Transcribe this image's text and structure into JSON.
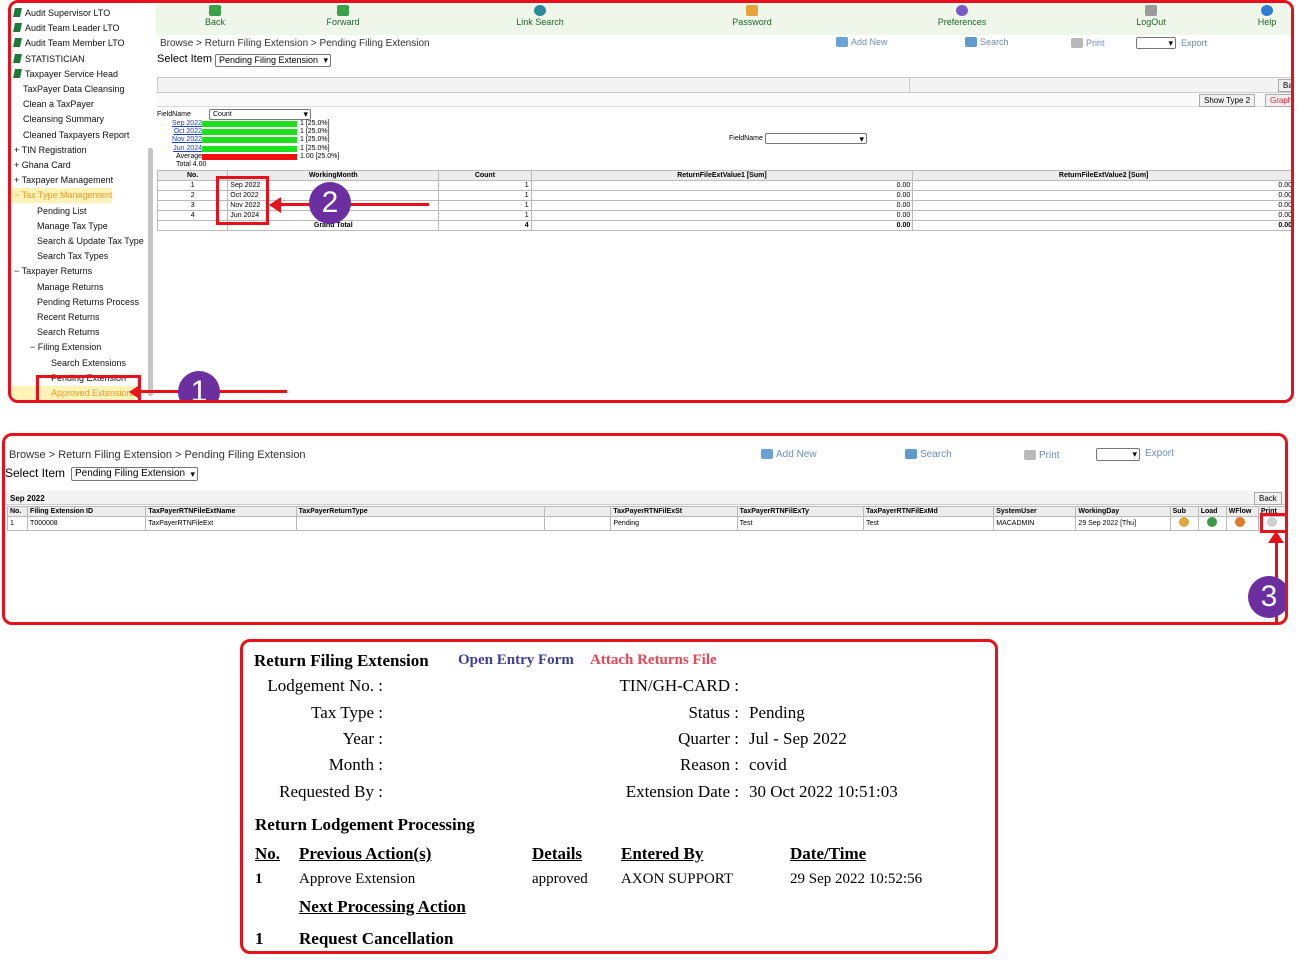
{
  "sidebar": {
    "items": [
      {
        "label": "Audit Supervisor LTO"
      },
      {
        "label": "Audit Team Leader LTO"
      },
      {
        "label": "Audit Team Member LTO"
      },
      {
        "label": "STATISTICIAN"
      },
      {
        "label": "Taxpayer Service Head"
      },
      {
        "label": "TaxPayer Data Cleansing"
      },
      {
        "label": "Clean a TaxPayer"
      },
      {
        "label": "Cleansing Summary"
      },
      {
        "label": "Cleaned Taxpayers Report"
      },
      {
        "label": "TIN Registration",
        "prefix": "+"
      },
      {
        "label": "Ghana Card",
        "prefix": "+"
      },
      {
        "label": "Taxpayer Management",
        "prefix": "+"
      },
      {
        "label": "Tax Type Management",
        "prefix": "−"
      },
      {
        "label": "Pending  List"
      },
      {
        "label": "Manage Tax Type"
      },
      {
        "label": "Search & Update Tax Type"
      },
      {
        "label": "Search Tax Types"
      },
      {
        "label": "Taxpayer Returns",
        "prefix": "−"
      },
      {
        "label": "Manage Returns"
      },
      {
        "label": "Pending Returns Process"
      },
      {
        "label": "Recent Returns"
      },
      {
        "label": "Search Returns"
      },
      {
        "label": "Filing Extension",
        "prefix": "−"
      },
      {
        "label": "Search Extensions"
      },
      {
        "label": "Pending Extension"
      },
      {
        "label": "Approved Extensions"
      }
    ]
  },
  "toolbar": {
    "back": "Back",
    "forward": "Forward",
    "link_search": "Link Search",
    "password": "Password",
    "preferences": "Preferences",
    "logout": "LogOut",
    "help": "Help"
  },
  "page": {
    "breadcrumb": "Browse > Return Filing Extension > Pending Filing Extension",
    "select_item_label": "Select Item",
    "select_item_value": "Pending Filing Extension",
    "add_new": "Add New",
    "search": "Search",
    "print": "Print",
    "export": "Export",
    "back_btn": "Bac",
    "show_type": "Show Type 2",
    "graph_btn": "Graph",
    "fieldname_label": "FieldName",
    "fieldname_value": "Count",
    "fieldname2_label": "FieldName"
  },
  "summary_chart": {
    "rows": [
      {
        "label": "Sep 2022",
        "value": "1 [25.0%]",
        "color": "#1ee01e"
      },
      {
        "label": "Oct 2022",
        "value": "1 [25.0%]",
        "color": "#1ee01e"
      },
      {
        "label": "Nov 2022",
        "value": "1 [25.0%]",
        "color": "#1ee01e"
      },
      {
        "label": "Jun 2024",
        "value": "1 [25.0%]",
        "color": "#1ee01e"
      },
      {
        "label": "Average",
        "value": "1.00 [25.0%]",
        "color": "#f01010"
      }
    ],
    "total": "Total 4.00"
  },
  "summary_table": {
    "headers": [
      "No.",
      "WorkingMonth",
      "Count",
      "ReturnFileExtValue1 [Sum]",
      "ReturnFileExtValue2 [Sum]"
    ],
    "rows": [
      [
        "1",
        "Sep 2022",
        "1",
        "0.00",
        "0.00"
      ],
      [
        "2",
        "Oct 2022",
        "1",
        "0.00",
        "0.00"
      ],
      [
        "3",
        "Nov 2022",
        "1",
        "0.00",
        "0.00"
      ],
      [
        "4",
        "Jun 2024",
        "1",
        "0.00",
        "0.00"
      ]
    ],
    "total_row": [
      "",
      "Grand Total",
      "4",
      "0.00",
      "0.00"
    ]
  },
  "detail": {
    "breadcrumb": "Browse > Return Filing Extension > Pending Filing Extension",
    "select_item_label": "Select Item",
    "select_item_value": "Pending Filing Extension",
    "add_new": "Add New",
    "search": "Search",
    "print": "Print",
    "export": "Export",
    "group_label": "Sep 2022",
    "back_btn": "Back",
    "headers": [
      "No.",
      "Filing Extension ID",
      "TaxPayerRTNFileExtName",
      "TaxPayerReturnType",
      "",
      "TaxPayerRTNFilExSt",
      "TaxPayerRTNFilExTy",
      "TaxPayerRTNFilExMd",
      "SystemUser",
      "WorkingDay",
      "Sub",
      "Load",
      "WFlow",
      "Print"
    ],
    "row": [
      "1",
      "T000008",
      "TaxPayerRTNFileExt",
      "",
      "",
      "Pending",
      "Test",
      "Test",
      "MACADMIN",
      "29 Sep 2022 [Thu]"
    ]
  },
  "form": {
    "title": "Return Filing Extension",
    "open_entry": "Open Entry Form",
    "attach": "Attach Returns File",
    "fields_left": [
      {
        "label": "Lodgement No. :",
        "value": ""
      },
      {
        "label": "Tax Type :",
        "value": ""
      },
      {
        "label": "Year :",
        "value": ""
      },
      {
        "label": "Month :",
        "value": ""
      },
      {
        "label": "Requested By :",
        "value": ""
      }
    ],
    "fields_right": [
      {
        "label": "TIN/GH-CARD :",
        "value": ""
      },
      {
        "label": "Status :",
        "value": "Pending"
      },
      {
        "label": "Quarter :",
        "value": "Jul - Sep 2022"
      },
      {
        "label": "Reason :",
        "value": "covid"
      },
      {
        "label": "Extension Date :",
        "value": "30 Oct 2022 10:51:03"
      }
    ],
    "section_title": "Return Lodgement Processing",
    "headers": [
      "No.",
      "Previous Action(s)",
      "Details",
      "Entered By",
      "Date/Time"
    ],
    "row": [
      "1",
      "Approve Extension",
      "approved",
      "AXON SUPPORT",
      "29 Sep 2022 10:52:56"
    ],
    "next_title": "Next Processing Action",
    "next_row": [
      "1",
      "Request Cancellation"
    ]
  },
  "markers": {
    "m1": "1",
    "m2": "2",
    "m3": "3"
  }
}
